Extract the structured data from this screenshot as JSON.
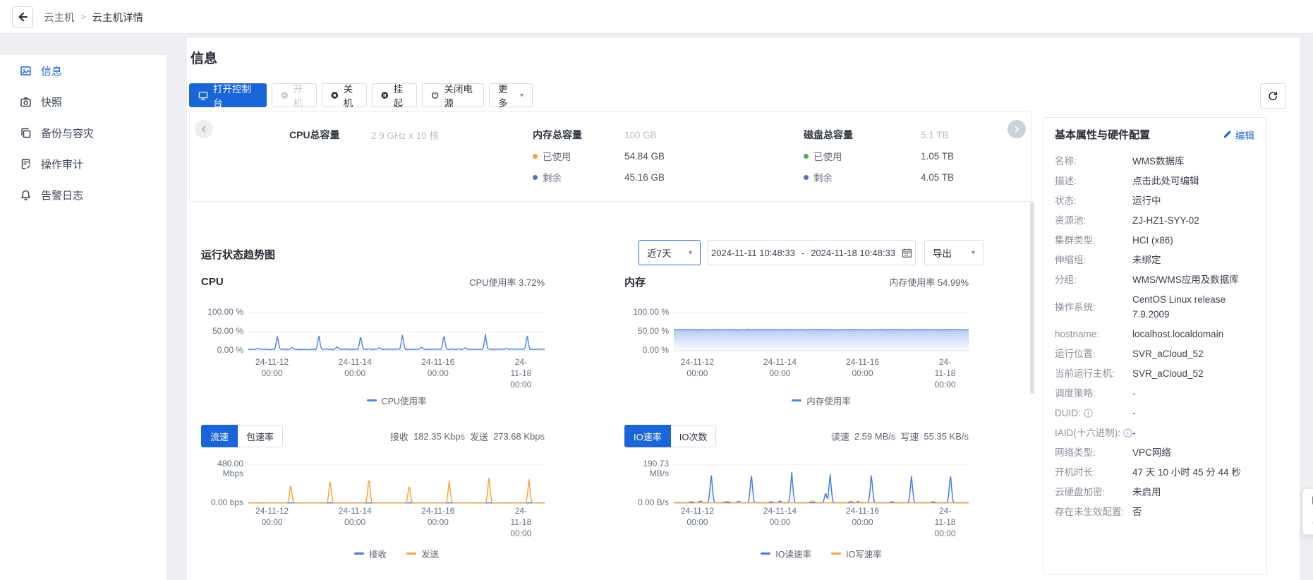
{
  "breadcrumb": {
    "root": "云主机",
    "sep": ">",
    "current": "云主机详情"
  },
  "sidebar": {
    "items": [
      {
        "label": "信息",
        "icon": "info-image-icon",
        "active": true
      },
      {
        "label": "快照",
        "icon": "camera-icon",
        "active": false
      },
      {
        "label": "备份与容灾",
        "icon": "backup-copy-icon",
        "active": false
      },
      {
        "label": "操作审计",
        "icon": "audit-doc-icon",
        "active": false
      },
      {
        "label": "告警日志",
        "icon": "alarm-bell-icon",
        "active": false
      }
    ]
  },
  "page": {
    "title": "信息"
  },
  "toolbar": {
    "console": "打开控制台",
    "power_on": "开机",
    "shutdown": "关机",
    "suspend": "挂起",
    "power_off": "关闭电源",
    "more": "更多"
  },
  "stats": {
    "cpu": {
      "label": "CPU总容量",
      "value": "2.9 GHz x 10 核"
    },
    "memory": {
      "label": "内存总容量",
      "total": "100 GB",
      "used_label": "已使用",
      "used": "54.84 GB",
      "free_label": "剩余",
      "free": "45.16 GB"
    },
    "disk": {
      "label": "磁盘总容量",
      "total": "5.1 TB",
      "used_label": "已使用",
      "used": "1.05 TB",
      "free_label": "剩余",
      "free": "4.05 TB"
    }
  },
  "trend": {
    "title": "运行状态趋势图",
    "range": "近7天",
    "date_start": "2024-11-11 10:48:33",
    "date_sep": "-",
    "date_end": "2024-11-18 10:48:33",
    "export": "导出"
  },
  "colors": {
    "accent": "#1a66d9",
    "chart_blue": "#4f86e0",
    "chart_orange": "#f6a43d",
    "mem_used_dot": "#f6a43d",
    "disk_used_dot": "#4db05f",
    "free_dot": "#5470c6"
  },
  "chart_data": [
    {
      "id": "cpu",
      "type": "line",
      "title": "CPU",
      "header_stat": "CPU使用率 3.72%",
      "ylim": [
        0,
        100
      ],
      "ymax": 100,
      "unit": "%",
      "x_range": [
        "2024-11-11 10:48:33",
        "2024-11-18 10:48:33"
      ],
      "grid": [
        {
          "f": 1,
          "label": "100.00 %"
        },
        {
          "f": 0.5,
          "label": "50.00 %"
        },
        {
          "f": 0,
          "label": "0.00 %"
        }
      ],
      "xticks": [
        {
          "f": 0.08,
          "label": "24-11-12\n00:00"
        },
        {
          "f": 0.36,
          "label": "24-11-14\n00:00"
        },
        {
          "f": 0.64,
          "label": "24-11-16\n00:00"
        },
        {
          "f": 0.92,
          "label": "24-11-18\n00:00"
        }
      ],
      "series": [
        {
          "name": "CPU使用率",
          "color": "#4f86e0",
          "baseline": 3.7,
          "jitter": 2.0,
          "fill": 0.14,
          "peaks": [
            [
              0.03,
              7,
              0.016
            ],
            [
              0.098,
              42
            ],
            [
              0.148,
              9,
              0.02
            ],
            [
              0.238,
              43
            ],
            [
              0.3,
              10,
              0.02
            ],
            [
              0.379,
              41
            ],
            [
              0.442,
              8,
              0.02
            ],
            [
              0.52,
              44
            ],
            [
              0.585,
              9,
              0.02
            ],
            [
              0.66,
              43
            ],
            [
              0.732,
              8,
              0.02
            ],
            [
              0.8,
              43
            ],
            [
              0.87,
              7,
              0.02
            ],
            [
              0.941,
              42
            ]
          ]
        }
      ]
    },
    {
      "id": "memory",
      "type": "area",
      "title": "内存",
      "header_stat": "内存使用率 54.99%",
      "ylim": [
        0,
        100
      ],
      "ymax": 100,
      "unit": "%",
      "grid": [
        {
          "f": 1,
          "label": "100.00 %"
        },
        {
          "f": 0.5,
          "label": "50.00 %"
        },
        {
          "f": 0,
          "label": "0.00 %"
        }
      ],
      "xticks": [
        {
          "f": 0.08,
          "label": "24-11-12\n00:00"
        },
        {
          "f": 0.36,
          "label": "24-11-14\n00:00"
        },
        {
          "f": 0.64,
          "label": "24-11-16\n00:00"
        },
        {
          "f": 0.92,
          "label": "24-11-18\n00:00"
        }
      ],
      "series": [
        {
          "name": "内存使用率",
          "color": "#4f86e0",
          "baseline": 55,
          "jitter": 1.3,
          "fill": 0.42,
          "peaks": []
        }
      ]
    },
    {
      "id": "network",
      "type": "line",
      "tabs": [
        {
          "label": "流速",
          "active": true
        },
        {
          "label": "包速率",
          "active": false
        }
      ],
      "summary": {
        "rx_label": "接收",
        "rx": "182.35 Kbps",
        "tx_label": "发送",
        "tx": "273.68 Kbps"
      },
      "ymax": 480,
      "unit": "Mbps",
      "grid": [
        {
          "f": 1,
          "label": "480.00 Mbps"
        },
        {
          "f": 0,
          "label": "0.00 bps"
        }
      ],
      "xticks": [
        {
          "f": 0.08,
          "label": "24-11-12\n00:00"
        },
        {
          "f": 0.36,
          "label": "24-11-14\n00:00"
        },
        {
          "f": 0.64,
          "label": "24-11-16\n00:00"
        },
        {
          "f": 0.92,
          "label": "24-11-18\n00:00"
        }
      ],
      "series": [
        {
          "name": "接收",
          "color": "#3f7be0",
          "baseline": 2.5,
          "jitter": 0.8,
          "fill": 0,
          "peaks": []
        },
        {
          "name": "发送",
          "color": "#f6a43d",
          "baseline": 3,
          "jitter": 1.0,
          "fill": 0.22,
          "peaks": [
            [
              0.143,
              250
            ],
            [
              0.276,
              300
            ],
            [
              0.407,
              335
            ],
            [
              0.543,
              240
            ],
            [
              0.678,
              285
            ],
            [
              0.812,
              350
            ],
            [
              0.947,
              300
            ]
          ]
        }
      ]
    },
    {
      "id": "io",
      "type": "line",
      "tabs": [
        {
          "label": "IO速率",
          "active": true
        },
        {
          "label": "IO次数",
          "active": false
        }
      ],
      "summary": {
        "rx_label": "读速",
        "rx": "2.59 MB/s",
        "tx_label": "写速",
        "tx": "55.35 KB/s"
      },
      "ymax": 190.73,
      "unit": "MB/s",
      "grid": [
        {
          "f": 1,
          "label": "190.73 MB/s"
        },
        {
          "f": 0,
          "label": "0.00 B/s"
        }
      ],
      "xticks": [
        {
          "f": 0.08,
          "label": "24-11-12\n00:00"
        },
        {
          "f": 0.36,
          "label": "24-11-14\n00:00"
        },
        {
          "f": 0.64,
          "label": "24-11-16\n00:00"
        },
        {
          "f": 0.92,
          "label": "24-11-18\n00:00"
        }
      ],
      "series": [
        {
          "name": "IO读速率",
          "color": "#3f7be0",
          "baseline": 2,
          "jitter": 1.0,
          "fill": 0.15,
          "peaks": [
            [
              0.09,
              12,
              0.012
            ],
            [
              0.127,
              150
            ],
            [
              0.22,
              10,
              0.012
            ],
            [
              0.263,
              150
            ],
            [
              0.36,
              12,
              0.012
            ],
            [
              0.4,
              152
            ],
            [
              0.515,
              55
            ],
            [
              0.53,
              152
            ],
            [
              0.625,
              9,
              0.012
            ],
            [
              0.67,
              146
            ],
            [
              0.806,
              140
            ],
            [
              0.938,
              148
            ]
          ]
        },
        {
          "name": "IO写速率",
          "color": "#f6a43d",
          "baseline": 1.5,
          "jitter": 0.9,
          "fill": 0,
          "peaks": [
            [
              0.06,
              9,
              0.02
            ],
            [
              0.18,
              10,
              0.025
            ],
            [
              0.33,
              8,
              0.02
            ],
            [
              0.47,
              12,
              0.02
            ],
            [
              0.6,
              10,
              0.02
            ],
            [
              0.74,
              9,
              0.02
            ],
            [
              0.88,
              8,
              0.02
            ]
          ]
        }
      ]
    }
  ],
  "panel": {
    "title": "基本属性与硬件配置",
    "edit": "编辑",
    "rows": [
      {
        "label": "名称:",
        "value": "WMS数据库"
      },
      {
        "label": "描述:",
        "value": "点击此处可编辑"
      },
      {
        "label": "状态:",
        "value": "运行中"
      },
      {
        "label": "资源池:",
        "value": "ZJ-HZ1-SYY-02"
      },
      {
        "label": "集群类型:",
        "value": "HCI (x86)"
      },
      {
        "label": "伸缩组:",
        "value": "未绑定"
      },
      {
        "label": "分组:",
        "value": "WMS/WMS应用及数据库"
      },
      {
        "label": "操作系统:",
        "value": "CentOS Linux release 7.9.2009"
      },
      {
        "label": "hostname:",
        "value": "localhost.localdomain"
      },
      {
        "label": "运行位置:",
        "value": "SVR_aCloud_52"
      },
      {
        "label": "当前运行主机:",
        "value": "SVR_aCloud_52"
      },
      {
        "label": "调度策略:",
        "value": "-"
      },
      {
        "label": "DUID:",
        "info": true,
        "value": "-"
      },
      {
        "label": "IAID(十六进制):",
        "info": true,
        "value": "-"
      },
      {
        "label": "网络类型:",
        "value": "VPC网络"
      },
      {
        "label": "开机时长:",
        "value": "47 天 10 小时 45 分 44 秒"
      },
      {
        "label": "云硬盘加密:",
        "value": "未启用"
      },
      {
        "label": "存在未生效配置:",
        "value": "否"
      }
    ]
  }
}
